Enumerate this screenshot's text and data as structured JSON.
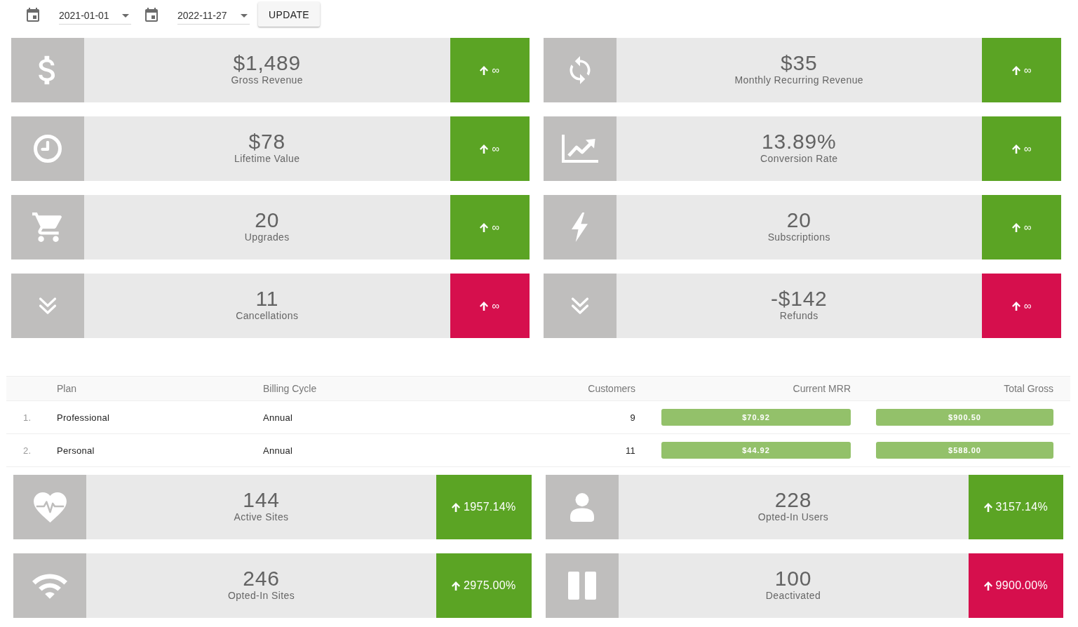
{
  "date_filter": {
    "start_date": {
      "value": "2021-01-01"
    },
    "end_date": {
      "value": "2022-11-27"
    },
    "update_button": "UPDATE"
  },
  "metrics": [
    {
      "value": "$1,489",
      "label": "Gross Revenue",
      "change": "∞",
      "color": "#5ba424"
    },
    {
      "value": "$35",
      "label": "Monthly Recurring Revenue",
      "change": "∞",
      "color": "#5ba424"
    },
    {
      "value": "$78",
      "label": "Lifetime Value",
      "change": "∞",
      "color": "#5ba424"
    },
    {
      "value": "13.89%",
      "label": "Conversion Rate",
      "change": "∞",
      "color": "#5ba424"
    },
    {
      "value": "20",
      "label": "Upgrades",
      "change": "∞",
      "color": "#5ba424"
    },
    {
      "value": "20",
      "label": "Subscriptions",
      "change": "∞",
      "color": "#5ba424"
    },
    {
      "value": "11",
      "label": "Cancellations",
      "change": "∞",
      "color": "#d60f4d"
    },
    {
      "value": "-$142",
      "label": "Refunds",
      "change": "∞",
      "color": "#d60f4d"
    }
  ],
  "plans_table": {
    "columns": [
      "Plan",
      "Billing Cycle",
      "Customers",
      "Current MRR",
      "Total Gross"
    ],
    "rows": [
      {
        "number": "1.",
        "plan": "Professional",
        "billing_cycle": "Annual",
        "customers": "9",
        "current_mrr": "$70.92",
        "total_gross": "$900.50"
      },
      {
        "number": "2.",
        "plan": "Personal",
        "billing_cycle": "Annual",
        "customers": "11",
        "current_mrr": "$44.92",
        "total_gross": "$588.00"
      }
    ]
  },
  "site_metrics": [
    {
      "value": "144",
      "label": "Active Sites",
      "change": "1957.14%",
      "color": "#5ba424"
    },
    {
      "value": "228",
      "label": "Opted-In Users",
      "change": "3157.14%",
      "color": "#5ba424"
    },
    {
      "value": "246",
      "label": "Opted-In Sites",
      "change": "2975.00%",
      "color": "#5ba424"
    },
    {
      "value": "100",
      "label": "Deactivated",
      "change": "9900.00%",
      "color": "#d60f4d"
    }
  ]
}
